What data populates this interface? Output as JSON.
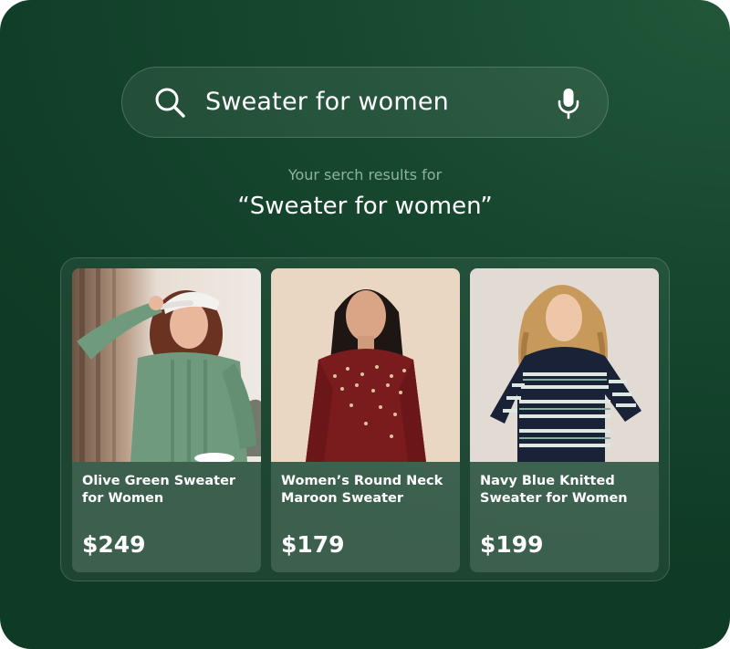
{
  "search": {
    "query": "Sweater for women",
    "search_icon": "search-icon",
    "mic_icon": "microphone-icon"
  },
  "results": {
    "caption": "Your serch results for",
    "query_display": "“Sweater for women”"
  },
  "products": [
    {
      "name": "Olive Green Sweater\nfor Women",
      "price": "$249",
      "color": "#6f9a7e"
    },
    {
      "name": "Women’s Round Neck\nMaroon Sweater",
      "price": "$179",
      "color": "#7a1c1e"
    },
    {
      "name": "Navy Blue Knitted\nSweater for Women",
      "price": "$199",
      "color": "#1a2238"
    }
  ],
  "colors": {
    "background": "#154a30",
    "accent_text": "#8fb29c",
    "text": "#ffffff"
  }
}
